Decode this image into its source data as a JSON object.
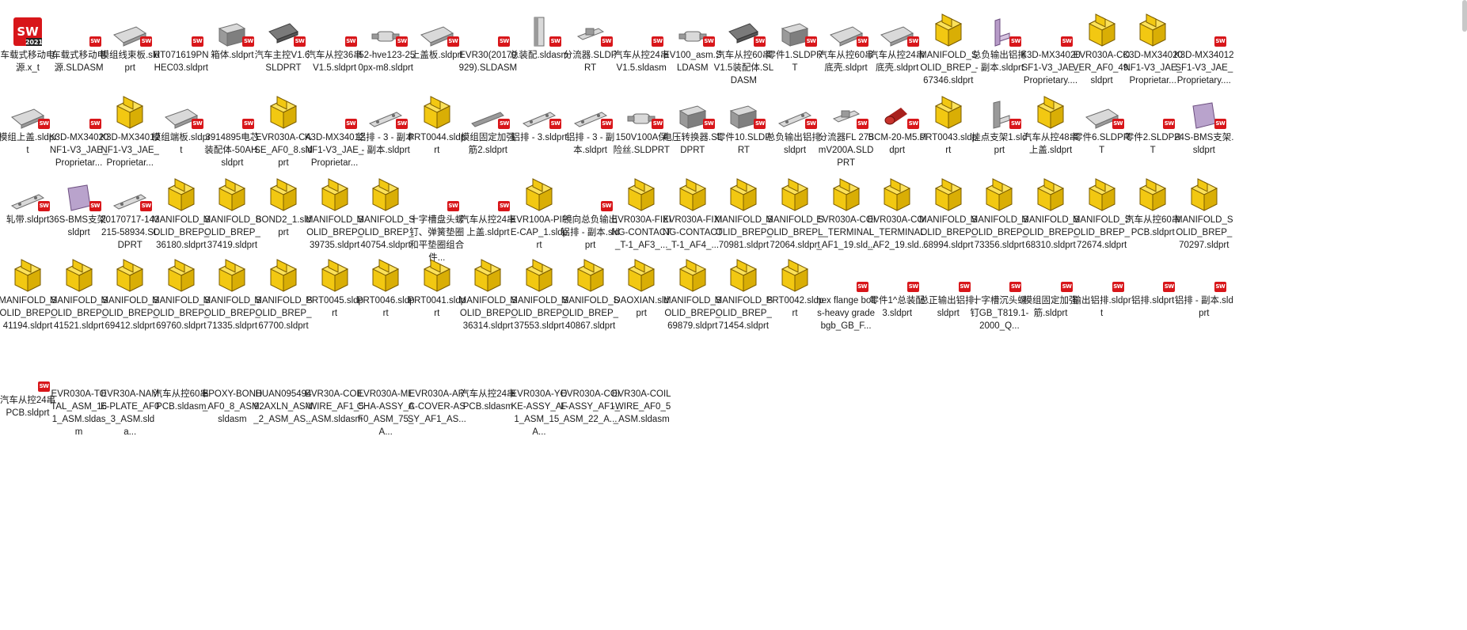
{
  "app_title_badge": "SW",
  "app_year": "2021",
  "badge_text": "SW",
  "colors": {
    "sw_red": "#d8161a",
    "part_yellow": "#f2c812",
    "part_outline": "#7a5c00"
  },
  "files": [
    {
      "name": "车载式移动电源.x_t",
      "icon": "solidworks-app-icon"
    },
    {
      "name": "车载式移动电源.SLDASM",
      "icon": "assembly-grey-icon"
    },
    {
      "name": "模组线束板.sldprt",
      "icon": "plate-grey-icon"
    },
    {
      "name": "RT071619PNHEC03.sldprt",
      "icon": "sw-file-icon"
    },
    {
      "name": "箱体.sldprt",
      "icon": "box-grey-icon"
    },
    {
      "name": "汽车主控V1.6.SLDPRT",
      "icon": "pcb-grey-icon"
    },
    {
      "name": "汽车从控36串V1.5.sldprt",
      "icon": "sw-file-icon"
    },
    {
      "name": "I52-hve123-250px-m8.sldprt",
      "icon": "fuse-grey-icon"
    },
    {
      "name": "上盖板.sldprt",
      "icon": "plate-grey-icon"
    },
    {
      "name": "EVR30(20170929).SLDASM",
      "icon": "sw-file-icon"
    },
    {
      "name": "总装配.sldasm",
      "icon": "column-grey-icon"
    },
    {
      "name": "分流器.SLDPRT",
      "icon": "shunt-grey-icon"
    },
    {
      "name": "汽车从控24串V1.5.sldasm",
      "icon": "sw-file-icon"
    },
    {
      "name": "EV100_asm.SLDASM",
      "icon": "fuse-grey-icon"
    },
    {
      "name": "汽车从控60串V1.5装配体.SLDASM",
      "icon": "pcb-dark-icon"
    },
    {
      "name": "零件1.SLDPRT",
      "icon": "box-grey-icon"
    },
    {
      "name": "汽车从控60串底壳.sldprt",
      "icon": "plate-grey-icon"
    },
    {
      "name": "汽车从控24串底壳.sldprt",
      "icon": "plate-grey-icon"
    },
    {
      "name": "MANIFOLD_SOLID_BREP_67346.sldprt",
      "icon": "part-yellow-icon"
    },
    {
      "name": "总负输出铝排 - 副本.sldprt",
      "icon": "bracket-purple-icon"
    },
    {
      "name": "K3D-MX34020SF1-V3_JAE_Proprietary....",
      "icon": "sw-file-icon"
    },
    {
      "name": "EVR030A-COVER_AF0_49.sldprt",
      "icon": "part-yellow-icon"
    },
    {
      "name": "K3D-MX34020NF1-V3_JAE_Proprietar...",
      "icon": "part-yellow-icon"
    },
    {
      "name": "K3D-MX34012SF1-V3_JAE_Proprietary....",
      "icon": "sw-file-icon"
    },
    {
      "name": "模组上盖.sldprt",
      "icon": "plate-grey-icon"
    },
    {
      "name": "K3D-MX34020NF1-V3_JAE_Proprietar...",
      "icon": "sw-file-icon"
    },
    {
      "name": "K3D-MX34012NF1-V3_JAE_Proprietar...",
      "icon": "part-yellow-icon"
    },
    {
      "name": "模组端板.sldprt",
      "icon": "plate-grey-icon"
    },
    {
      "name": "3914895电芯装配体-50AH.sldprt",
      "icon": "sw-file-icon"
    },
    {
      "name": "EVR030A-CASE_AF0_8.sldprt",
      "icon": "part-yellow-icon"
    },
    {
      "name": "K3D-MX34012NF1-V3_JAE_Proprietar...",
      "icon": "sw-file-icon"
    },
    {
      "name": "铝排 - 3 - 副本 - 副本.sldprt",
      "icon": "busbar-grey-icon"
    },
    {
      "name": "PRT0044.sldprt",
      "icon": "part-yellow-icon"
    },
    {
      "name": "模组固定加强筋2.sldprt",
      "icon": "rail-grey-icon"
    },
    {
      "name": "铝排 - 3.sldprt",
      "icon": "busbar-grey-icon"
    },
    {
      "name": "铝排 - 3 - 副本.sldprt",
      "icon": "busbar-grey-icon"
    },
    {
      "name": "150V100A保险丝.SLDPRT",
      "icon": "fuse-grey-icon"
    },
    {
      "name": "电压转换器.SLDPRT",
      "icon": "box-grey-icon"
    },
    {
      "name": "零件10.SLDPRT",
      "icon": "box-grey-icon"
    },
    {
      "name": "总负输出铝排.sldprt",
      "icon": "busbar-grey-icon"
    },
    {
      "name": "分流器FL 275mV200A.SLDPRT",
      "icon": "shunt-grey-icon"
    },
    {
      "name": "BCM-20-M5.sldprt",
      "icon": "cylinder-red-icon"
    },
    {
      "name": "PRT0043.sldprt",
      "icon": "part-yellow-icon"
    },
    {
      "name": "挂点支架1.sldprt",
      "icon": "bracket-grey-icon"
    },
    {
      "name": "汽车从控48串上盖.sldprt",
      "icon": "part-yellow-icon"
    },
    {
      "name": "零件6.SLDPRT",
      "icon": "plate-grey-icon"
    },
    {
      "name": "零件2.SLDPRT",
      "icon": "sw-file-icon"
    },
    {
      "name": "24S-BMS支架.sldprt",
      "icon": "plate-purple-icon"
    },
    {
      "name": "轧带.sldprt",
      "icon": "busbar-grey-icon"
    },
    {
      "name": "36S-BMS支架.sldprt",
      "icon": "plate-purple-icon"
    },
    {
      "name": "20170717-143215-58934.SLDPRT",
      "icon": "busbar-grey-icon"
    },
    {
      "name": "MANIFOLD_SOLID_BREP_36180.sldprt",
      "icon": "part-yellow-icon"
    },
    {
      "name": "MANIFOLD_SOLID_BREP_37419.sldprt",
      "icon": "part-yellow-icon"
    },
    {
      "name": "BOND2_1.sldprt",
      "icon": "part-yellow-icon"
    },
    {
      "name": "MANIFOLD_SOLID_BREP_39735.sldprt",
      "icon": "part-yellow-icon"
    },
    {
      "name": "MANIFOLD_SOLID_BREP_40754.sldprt",
      "icon": "part-yellow-icon"
    },
    {
      "name": "十字槽盘头螺钉、弹簧垫圈和平垫圈组合件...",
      "icon": "sw-file-icon"
    },
    {
      "name": "汽车从控24串上盖.sldprt",
      "icon": "sw-file-icon"
    },
    {
      "name": "EVR100A-PIPE-CAP_1.sldprt",
      "icon": "part-yellow-icon"
    },
    {
      "name": "镜向总负输出铝排 - 副本.sldprt",
      "icon": "sw-file-icon"
    },
    {
      "name": "EVR030A-FIXING-CONTACT_T-1_AF3_...",
      "icon": "part-yellow-icon"
    },
    {
      "name": "EVR030A-FIXING-CONTACT_T-1_AF4_...",
      "icon": "part-yellow-icon"
    },
    {
      "name": "MANIFOLD_SOLID_BREP_70981.sldprt",
      "icon": "part-yellow-icon"
    },
    {
      "name": "MANIFOLD_SOLID_BREP_72064.sldprt",
      "icon": "part-yellow-icon"
    },
    {
      "name": "EVR030A-COIL_TERMINAL_AF1_19.sld...",
      "icon": "part-yellow-icon"
    },
    {
      "name": "EVR030A-COIL_TERMINAL_AF2_19.sld...",
      "icon": "part-yellow-icon"
    },
    {
      "name": "MANIFOLD_SOLID_BREP_68994.sldprt",
      "icon": "part-yellow-icon"
    },
    {
      "name": "MANIFOLD_SOLID_BREP_73356.sldprt",
      "icon": "part-yellow-icon"
    },
    {
      "name": "MANIFOLD_SOLID_BREP_68310.sldprt",
      "icon": "part-yellow-icon"
    },
    {
      "name": "MANIFOLD_SOLID_BREP_72674.sldprt",
      "icon": "part-yellow-icon"
    },
    {
      "name": "汽车从控60串PCB.sldprt",
      "icon": "part-yellow-icon"
    },
    {
      "name": "MANIFOLD_SOLID_BREP_70297.sldprt",
      "icon": "part-yellow-icon"
    },
    {
      "name": "MANIFOLD_SOLID_BREP_41194.sldprt",
      "icon": "part-yellow-icon"
    },
    {
      "name": "MANIFOLD_SOLID_BREP_41521.sldprt",
      "icon": "part-yellow-icon"
    },
    {
      "name": "MANIFOLD_SOLID_BREP_69412.sldprt",
      "icon": "part-yellow-icon"
    },
    {
      "name": "MANIFOLD_SOLID_BREP_69760.sldprt",
      "icon": "part-yellow-icon"
    },
    {
      "name": "MANIFOLD_SOLID_BREP_71335.sldprt",
      "icon": "part-yellow-icon"
    },
    {
      "name": "MANIFOLD_SOLID_BREP_67700.sldprt",
      "icon": "part-yellow-icon"
    },
    {
      "name": "PRT0045.sldprt",
      "icon": "part-yellow-icon"
    },
    {
      "name": "PRT0046.sldprt",
      "icon": "part-yellow-icon"
    },
    {
      "name": "PRT0041.sldprt",
      "icon": "part-yellow-icon"
    },
    {
      "name": "MANIFOLD_SOLID_BREP_36314.sldprt",
      "icon": "part-yellow-icon"
    },
    {
      "name": "MANIFOLD_SOLID_BREP_37553.sldprt",
      "icon": "part-yellow-icon"
    },
    {
      "name": "MANIFOLD_SOLID_BREP_40867.sldprt",
      "icon": "part-yellow-icon"
    },
    {
      "name": "DAOXIAN.sldprt",
      "icon": "part-yellow-icon"
    },
    {
      "name": "MANIFOLD_SOLID_BREP_69879.sldprt",
      "icon": "part-yellow-icon"
    },
    {
      "name": "MANIFOLD_SOLID_BREP_71454.sldprt",
      "icon": "part-yellow-icon"
    },
    {
      "name": "PRT0042.sldprt",
      "icon": "part-yellow-icon"
    },
    {
      "name": "hex flange bolts-heavy grade bgb_GB_F...",
      "icon": "sw-file-icon"
    },
    {
      "name": "零件1^总装配3.sldprt",
      "icon": "sw-file-icon"
    },
    {
      "name": "总正输出铝排.sldprt",
      "icon": "sw-file-icon"
    },
    {
      "name": "十字槽沉头螺钉GB_T819.1-2000_Q...",
      "icon": "sw-file-icon"
    },
    {
      "name": "模组固定加强筋.sldprt",
      "icon": "sw-file-icon"
    },
    {
      "name": "输出铝排.sldprt",
      "icon": "sw-file-icon"
    },
    {
      "name": "铝排.sldprt",
      "icon": "sw-file-icon"
    },
    {
      "name": "铝排 - 副本.sldprt",
      "icon": "sw-file-icon"
    },
    {
      "name": "汽车从控24串PCB.sldprt",
      "icon": "sw-file-icon"
    },
    {
      "name": "EVR030A-TOTAL_ASM_161_ASM.sldasm",
      "icon": "none"
    },
    {
      "name": "EVR30A-NAME-PLATE_AF0_3_ASM.slda...",
      "icon": "none"
    },
    {
      "name": "汽车从控60串PCB.sldasm",
      "icon": "none"
    },
    {
      "name": "EPOXY-BOND_AF0_8_ASM.sldasm",
      "icon": "none"
    },
    {
      "name": "HUAN09549492AXLN_ASM_2_ASM_AS...",
      "icon": "none"
    },
    {
      "name": "EVR30A-COIL-WIRE_AF1_5_ASM.sldasm",
      "icon": "none"
    },
    {
      "name": "EVR030A-MECHA-ASSY_AF0_ASM_75_A...",
      "icon": "none"
    },
    {
      "name": "EVR030A-ARC-COVER-ASSY_AF1_AS...",
      "icon": "none"
    },
    {
      "name": "汽车从控24串PCB.sldasm",
      "icon": "none"
    },
    {
      "name": "EVR030A-YOKE-ASSY_AF1_ASM_15_A...",
      "icon": "none"
    },
    {
      "name": "EVR030A-COIL-ASSY_AF1_ASM_22_A...",
      "icon": "none"
    },
    {
      "name": "EVR30A-COIL-WIRE_AF0_5_ASM.sldasm",
      "icon": "none"
    }
  ]
}
